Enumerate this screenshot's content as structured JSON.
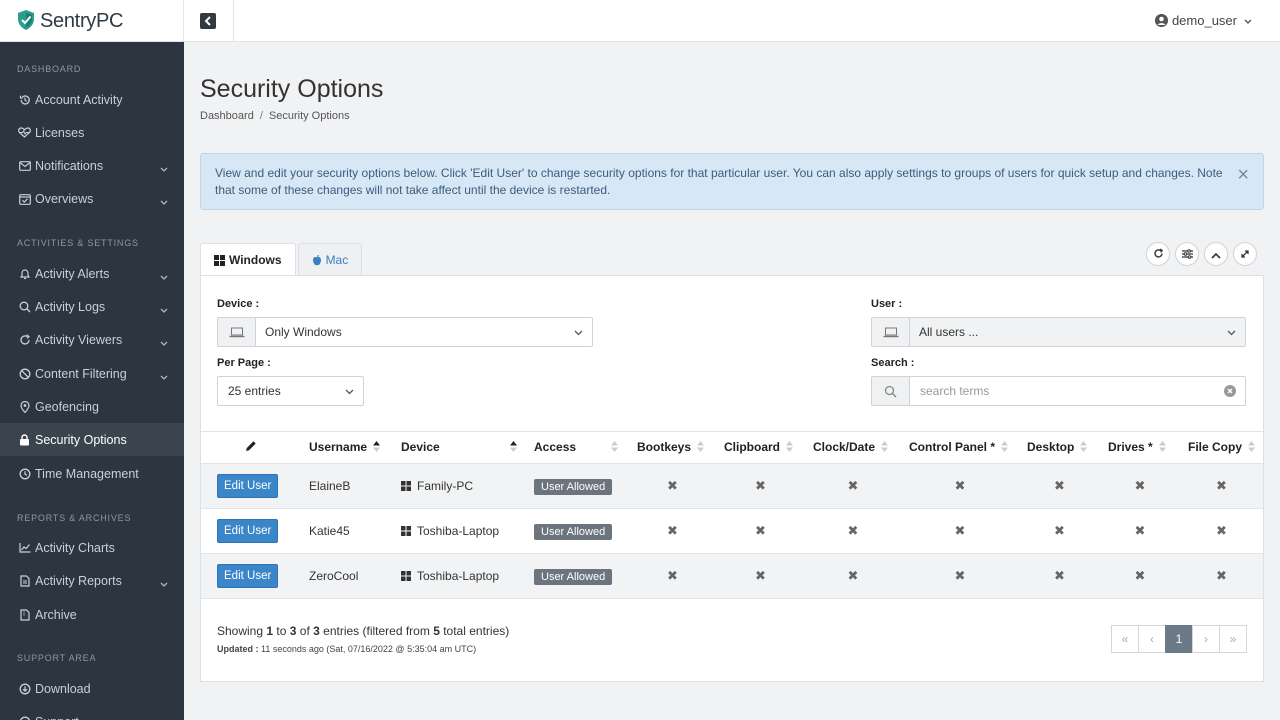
{
  "brand": {
    "name": "SentryPC"
  },
  "user": {
    "name": "demo_user"
  },
  "sidebar": {
    "sections": [
      {
        "label": "DASHBOARD",
        "items": [
          {
            "label": "Account Activity",
            "icon": "history-icon",
            "chevron": false
          },
          {
            "label": "Licenses",
            "icon": "heart-pulse-icon",
            "chevron": false
          },
          {
            "label": "Notifications",
            "icon": "envelope-icon",
            "chevron": true
          },
          {
            "label": "Overviews",
            "icon": "calendar-check-icon",
            "chevron": true
          }
        ]
      },
      {
        "label": "ACTIVITIES & SETTINGS",
        "items": [
          {
            "label": "Activity Alerts",
            "icon": "bell-icon",
            "chevron": true
          },
          {
            "label": "Activity Logs",
            "icon": "search-icon",
            "chevron": true
          },
          {
            "label": "Activity Viewers",
            "icon": "refresh-icon",
            "chevron": true
          },
          {
            "label": "Content Filtering",
            "icon": "ban-icon",
            "chevron": true
          },
          {
            "label": "Geofencing",
            "icon": "map-pin-icon",
            "chevron": false
          },
          {
            "label": "Security Options",
            "icon": "lock-icon",
            "chevron": false,
            "active": true
          },
          {
            "label": "Time Management",
            "icon": "clock-icon",
            "chevron": false
          }
        ]
      },
      {
        "label": "REPORTS & ARCHIVES",
        "items": [
          {
            "label": "Activity Charts",
            "icon": "line-chart-icon",
            "chevron": false
          },
          {
            "label": "Activity Reports",
            "icon": "file-icon",
            "chevron": true
          },
          {
            "label": "Archive",
            "icon": "file-archive-icon",
            "chevron": false
          }
        ]
      },
      {
        "label": "SUPPORT AREA",
        "items": [
          {
            "label": "Download",
            "icon": "download-icon",
            "chevron": false
          },
          {
            "label": "Support",
            "icon": "help-icon",
            "chevron": true
          }
        ]
      }
    ]
  },
  "page": {
    "title": "Security Options",
    "breadcrumb": [
      "Dashboard",
      "Security Options"
    ],
    "alert": "View and edit your security options below.  Click 'Edit User' to change security options for that particular user.  You can also apply settings to groups of users for quick setup and changes.  Note that some of these changes will not take affect until the device is restarted."
  },
  "tabs": [
    {
      "label": "Windows",
      "icon": "windows-icon",
      "active": true
    },
    {
      "label": "Mac",
      "icon": "apple-icon",
      "active": false
    }
  ],
  "filters": {
    "device_label": "Device :",
    "device_value": "Only Windows",
    "per_page_label": "Per Page :",
    "per_page_value": "25 entries",
    "user_label": "User :",
    "user_value": "All users ...",
    "search_label": "Search :",
    "search_placeholder": "search terms"
  },
  "table": {
    "columns": [
      "Username",
      "Device",
      "Access",
      "Bootkeys",
      "Clipboard",
      "Clock/Date",
      "Control Panel *",
      "Desktop",
      "Drives *",
      "File Copy"
    ],
    "edit_label": "Edit User",
    "rows": [
      {
        "username": "ElaineB",
        "device": "Family-PC",
        "access": "User Allowed",
        "mark": "✖"
      },
      {
        "username": "Katie45",
        "device": "Toshiba-Laptop",
        "access": "User Allowed",
        "mark": "✖"
      },
      {
        "username": "ZeroCool",
        "device": "Toshiba-Laptop",
        "access": "User Allowed",
        "mark": "✖"
      }
    ]
  },
  "footer": {
    "showing_pre": "Showing ",
    "from": "1",
    "to_word": " to ",
    "to": "3",
    "of_word": " of ",
    "total": "3",
    "entries_word": " entries (filtered from ",
    "filtered": "5",
    "tail": " total entries)",
    "updated_label": "Updated :",
    "updated_value": " 11 seconds ago (Sat, 07/16/2022 @ 5:35:04 am UTC)",
    "pager": [
      "«",
      "‹",
      "1",
      "›",
      "»"
    ]
  }
}
